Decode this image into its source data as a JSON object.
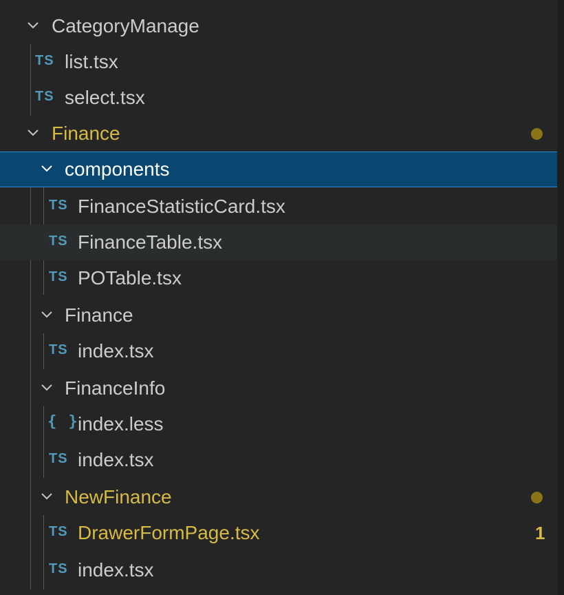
{
  "explorer": {
    "rows": [
      {
        "label": "CategoryManage",
        "kind": "folder",
        "expanded": true,
        "state": "normal"
      },
      {
        "label": "list.tsx",
        "kind": "file",
        "icon": "TS",
        "state": "normal"
      },
      {
        "label": "select.tsx",
        "kind": "file",
        "icon": "TS",
        "state": "normal"
      },
      {
        "label": "Finance",
        "kind": "folder",
        "expanded": true,
        "state": "modified",
        "decoration": "modified-dot"
      },
      {
        "label": "components",
        "kind": "folder",
        "expanded": true,
        "state": "selected"
      },
      {
        "label": "FinanceStatisticCard.tsx",
        "kind": "file",
        "icon": "TS",
        "state": "normal"
      },
      {
        "label": "FinanceTable.tsx",
        "kind": "file",
        "icon": "TS",
        "state": "hover"
      },
      {
        "label": "POTable.tsx",
        "kind": "file",
        "icon": "TS",
        "state": "normal"
      },
      {
        "label": "Finance",
        "kind": "folder",
        "expanded": true,
        "state": "normal"
      },
      {
        "label": "index.tsx",
        "kind": "file",
        "icon": "TS",
        "state": "normal"
      },
      {
        "label": "FinanceInfo",
        "kind": "folder",
        "expanded": true,
        "state": "normal"
      },
      {
        "label": "index.less",
        "kind": "file",
        "icon": "{ }",
        "state": "normal"
      },
      {
        "label": "index.tsx",
        "kind": "file",
        "icon": "TS",
        "state": "normal"
      },
      {
        "label": "NewFinance",
        "kind": "folder",
        "expanded": true,
        "state": "modified",
        "decoration": "modified-dot"
      },
      {
        "label": "DrawerFormPage.tsx",
        "kind": "file",
        "icon": "TS",
        "state": "modified",
        "badge": "1"
      },
      {
        "label": "index.tsx",
        "kind": "file",
        "icon": "TS",
        "state": "normal"
      }
    ]
  },
  "colors": {
    "background": "#252526",
    "selected_background": "#094771",
    "selected_border": "#2f8bd6",
    "hover_background": "#2a2d2e",
    "text": "#cccccc",
    "modified_text": "#d7ba44",
    "modified_dot": "#8a7418",
    "ts_icon": "#519aba"
  }
}
